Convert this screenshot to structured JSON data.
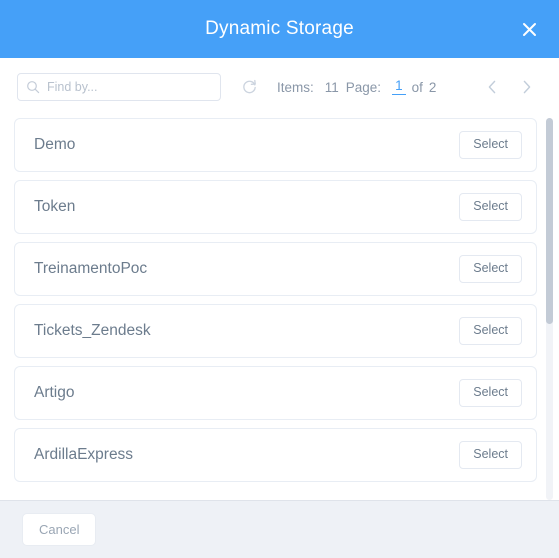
{
  "header": {
    "title": "Dynamic Storage",
    "close_icon": "close-icon"
  },
  "toolbar": {
    "search": {
      "placeholder": "Find by...",
      "value": "",
      "icon": "search-icon"
    },
    "refresh_icon": "refresh-icon",
    "items_label": "Items:",
    "items_count": "11",
    "page_label": "Page:",
    "page_current": "1",
    "page_of": "of",
    "page_total": "2",
    "prev_icon": "chevron-left-icon",
    "next_icon": "chevron-right-icon"
  },
  "list": {
    "select_label": "Select",
    "items": [
      {
        "name": "Demo"
      },
      {
        "name": "Token"
      },
      {
        "name": "TreinamentoPoc"
      },
      {
        "name": "Tickets_Zendesk"
      },
      {
        "name": "Artigo"
      },
      {
        "name": "ArdillaExpress"
      }
    ]
  },
  "footer": {
    "cancel_label": "Cancel"
  },
  "colors": {
    "header_blue": "#45a0f8",
    "accent": "#45a0f8",
    "text_muted": "#6c7c8d",
    "footer_bg": "#eef1f6",
    "border": "#e8edf4"
  }
}
